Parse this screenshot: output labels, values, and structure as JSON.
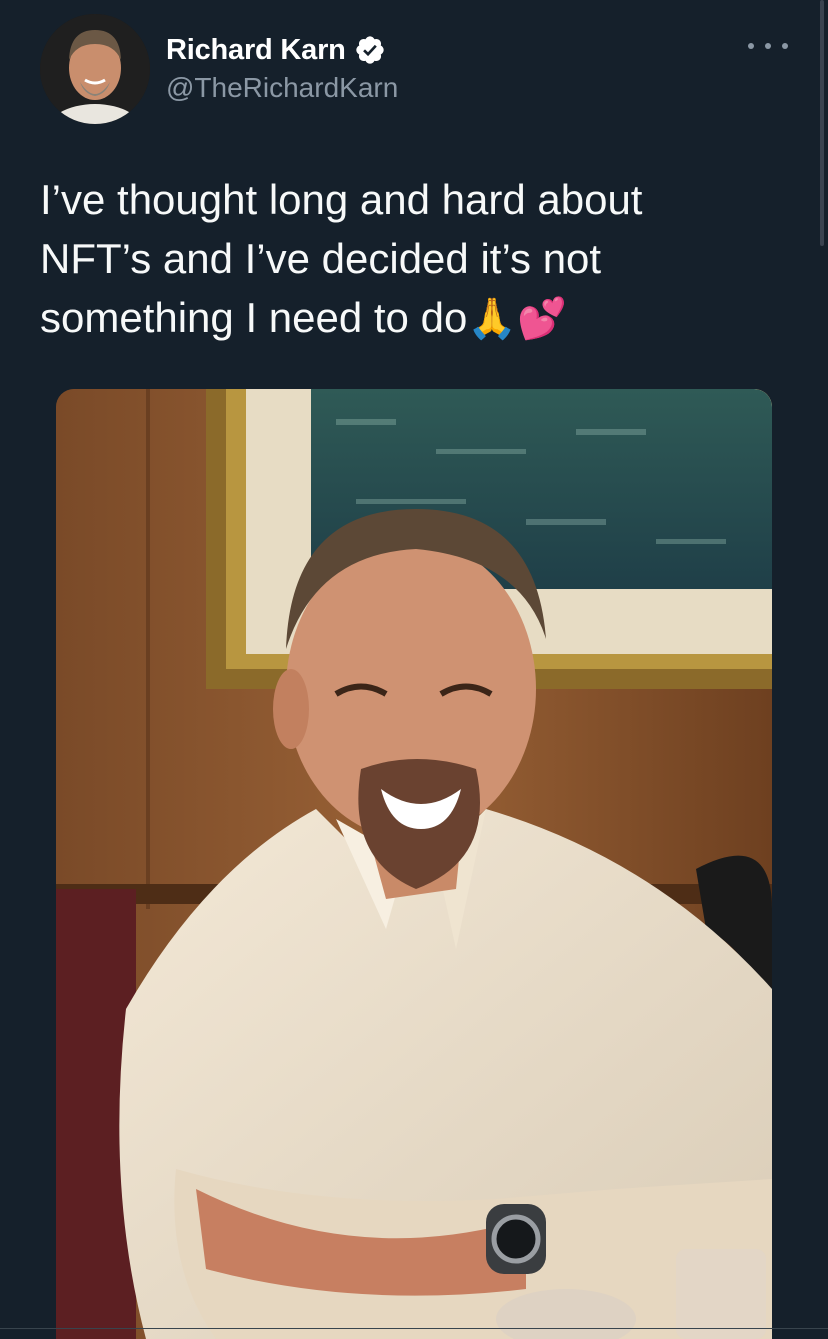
{
  "author": {
    "display_name": "Richard Karn",
    "handle": "@TheRichardKarn",
    "verified": true
  },
  "tweet": {
    "text": "I’ve thought long and hard about\nNFT’s and I’ve decided it’s not\nsomething I need to do",
    "emojis": "🙏💕"
  },
  "icons": {
    "verified": "verified-badge-icon",
    "more": "more-options-icon"
  },
  "colors": {
    "background": "#15202b",
    "secondary_text": "#8b98a5",
    "primary_text": "#f7f9f9",
    "verified_badge": "#ffffff"
  }
}
